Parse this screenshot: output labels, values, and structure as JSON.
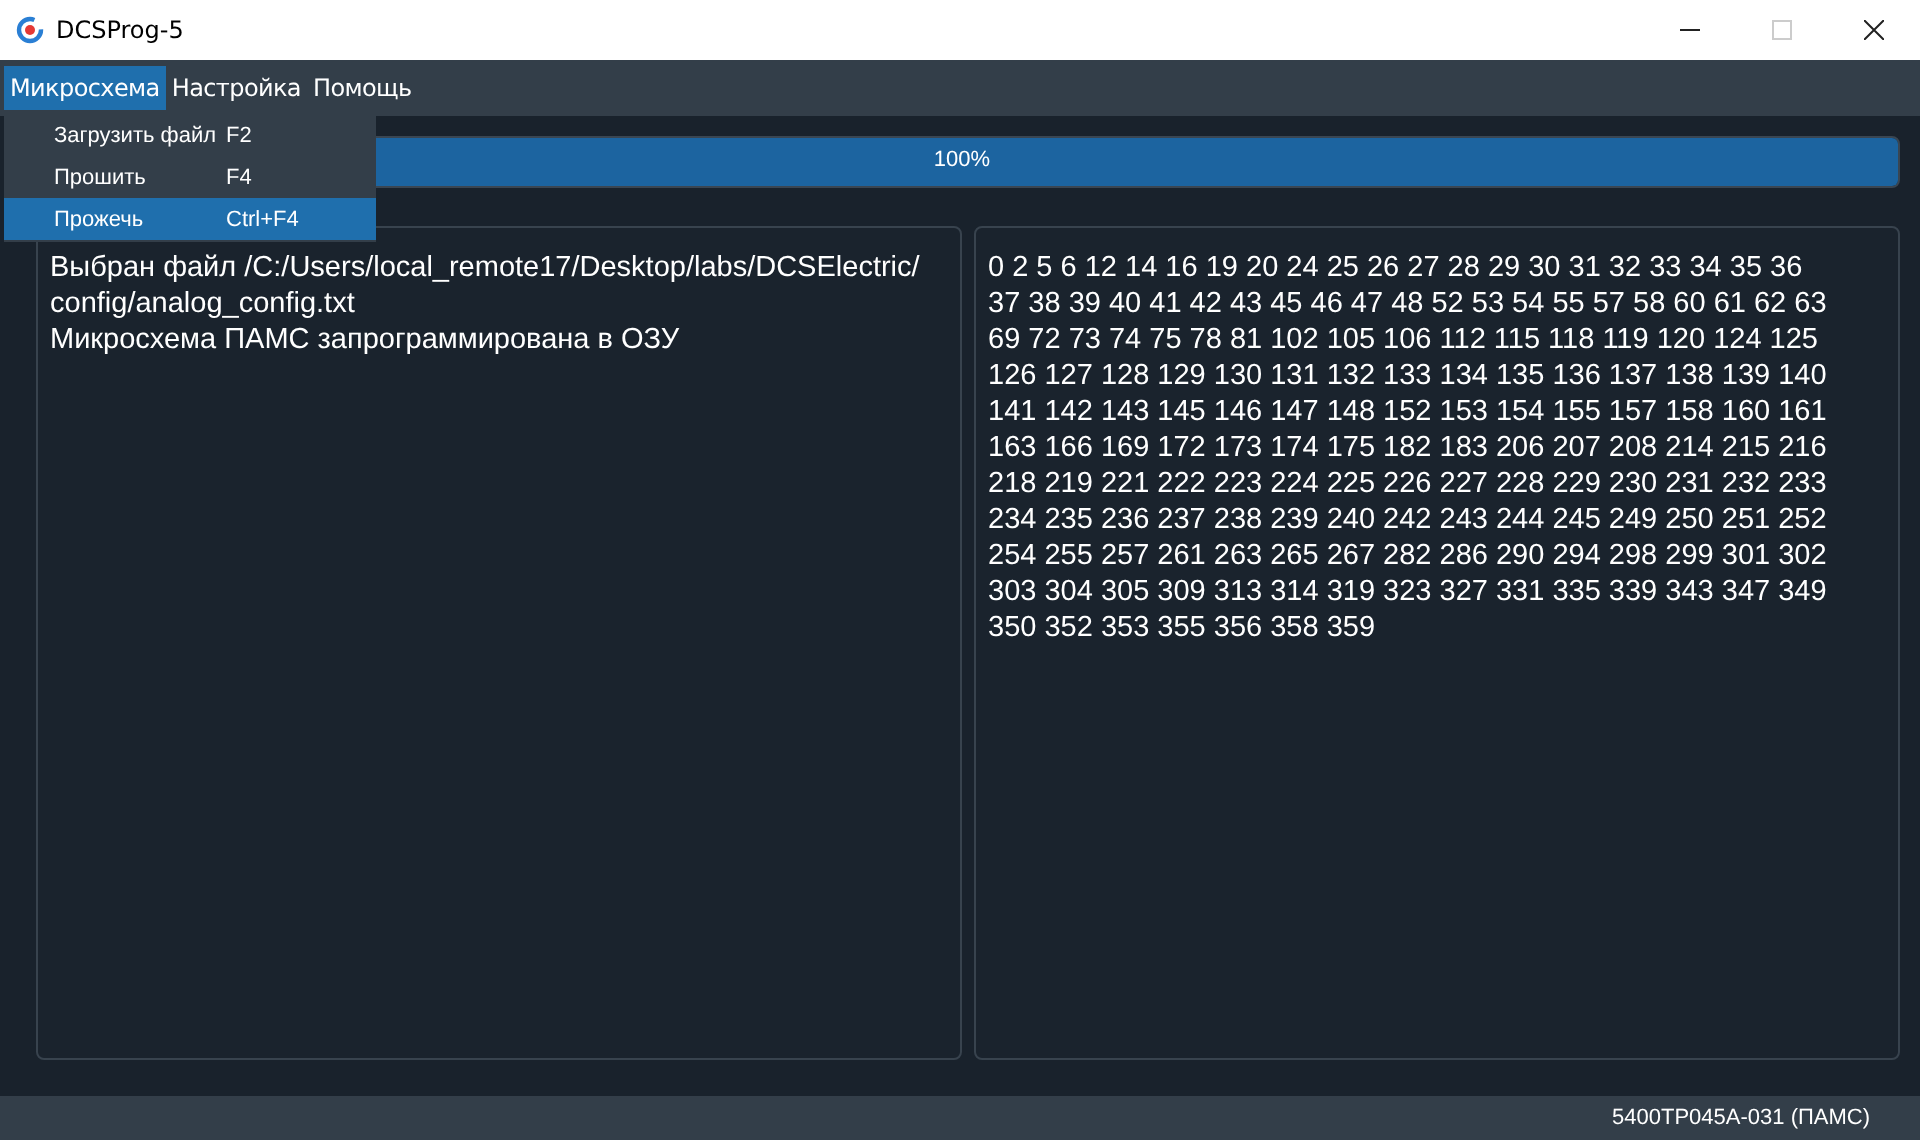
{
  "window": {
    "title": "DCSProg-5",
    "maximize_disabled": true
  },
  "menu": [
    {
      "label": "Микросхема",
      "selected": true
    },
    {
      "label": "Настройка",
      "selected": false
    },
    {
      "label": "Помощь",
      "selected": false
    }
  ],
  "dropdown": [
    {
      "label": "Загрузить файл",
      "shortcut": "F2",
      "selected": false
    },
    {
      "label": "Прошить",
      "shortcut": "F4",
      "selected": false
    },
    {
      "label": "Прожечь",
      "shortcut": "Ctrl+F4",
      "selected": true
    }
  ],
  "progress": {
    "level": 1,
    "reading": "100%"
  },
  "log_lines": [
    "Выбран файл /C:/Users/local_remote17/Desktop/labs/DCSElectric/",
    "config/analog_config.txt",
    "Микросхема ПАМС запрограммирована в ОЗУ"
  ],
  "number_lines": [
    "0 2 5 6 12 14 16 19 20 24 25 26 27 28 29 30 31 32 33 34 35 36",
    "37 38 39 40 41 42 43 45 46 47 48 52 53 54 55 57 58 60 61 62 63",
    "69 72 73 74 75 78 81 102 105 106 112 115 118 119 120 124 125",
    "126 127 128 129 130 131 132 133 134 135 136 137 138 139 140",
    "141 142 143 145 146 147 148 152 153 154 155 157 158 160 161",
    "163 166 169 172 173 174 175 182 183 206 207 208 214 215 216",
    "218 219 221 222 223 224 225 226 227 228 229 230 231 232 233",
    "234 235 236 237 238 239 240 242 243 244 245 249 250 251 252",
    "254 255 257 261 263 265 267 282 286 290 294 298 299 301 302",
    "303 304 305 309 313 314 319 323 327 331 335 339 343 347 349",
    "350 352 353 355 356 358 359"
  ],
  "status_bar": {
    "chip": "5400TP045A-031 (ПАМС)"
  }
}
